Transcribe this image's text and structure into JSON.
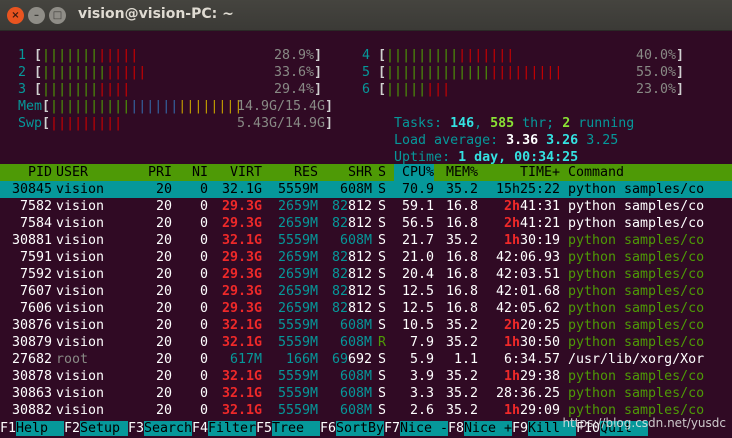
{
  "window": {
    "title": "vision@vision-PC: ~",
    "close_glyph": "×",
    "min_glyph": "–",
    "max_glyph": "□"
  },
  "cpu_meters": [
    {
      "label": "1",
      "bar": "||||||||||||",
      "value": "28.9%",
      "fraction": 0.289
    },
    {
      "label": "2",
      "bar": "|||||||||||||",
      "value": "33.6%",
      "fraction": 0.336
    },
    {
      "label": "3",
      "bar": "|||||||||||",
      "value": "29.4%",
      "fraction": 0.294
    },
    {
      "label": "4",
      "bar": "||||||||||||||||",
      "value": "40.0%",
      "fraction": 0.4
    },
    {
      "label": "5",
      "bar": "||||||||||||||||||||||",
      "value": "55.0%",
      "fraction": 0.55
    },
    {
      "label": "6",
      "bar": "||||||||",
      "value": "23.0%",
      "fraction": 0.23
    }
  ],
  "mem": {
    "label": "Mem",
    "bar": "||||||||||||||||||||||||",
    "value": "14.9G/15.4G"
  },
  "swp": {
    "label": "Swp",
    "bar": "|||||||||",
    "value": "5.43G/14.9G"
  },
  "tasks": {
    "prefix": "Tasks: ",
    "tasks": "146",
    "sep1": ", ",
    "threads": "585",
    "thr": " thr; ",
    "running": "2",
    "running_label": " running"
  },
  "load": {
    "prefix": "Load average: ",
    "l1": "3.36",
    "l5": "3.26",
    "l15": "3.25"
  },
  "uptime": {
    "prefix": "Uptime: ",
    "value": "1 day, 00:34:25"
  },
  "columns": [
    "PID",
    "USER",
    "PRI",
    "NI",
    "VIRT",
    "RES",
    "SHR",
    "S",
    "CPU%",
    "MEM%",
    "TIME+",
    "Command"
  ],
  "processes": [
    {
      "pid": "30845",
      "user": "vision",
      "pri": "20",
      "ni": "0",
      "virt": "32.1G",
      "res": "5559M",
      "shr": "608M",
      "s": "S",
      "cpu": "70.9",
      "mem": "35.2",
      "time_h": "15h",
      "time_r": "25:22",
      "cmd": "python samples/co",
      "selected": true
    },
    {
      "pid": "7582",
      "user": "vision",
      "pri": "20",
      "ni": "0",
      "virt": "29.3G",
      "res": "2659M",
      "shr": "82812",
      "s": "S",
      "cpu": "59.1",
      "mem": "16.8",
      "time_h": "2h",
      "time_r": "41:31",
      "cmd": "python samples/co"
    },
    {
      "pid": "7584",
      "user": "vision",
      "pri": "20",
      "ni": "0",
      "virt": "29.3G",
      "res": "2659M",
      "shr": "82812",
      "s": "S",
      "cpu": "56.5",
      "mem": "16.8",
      "time_h": "2h",
      "time_r": "41:21",
      "cmd": "python samples/co"
    },
    {
      "pid": "30881",
      "user": "vision",
      "pri": "20",
      "ni": "0",
      "virt": "32.1G",
      "res": "5559M",
      "shr": "608M",
      "s": "S",
      "cpu": "21.7",
      "mem": "35.2",
      "time_h": "1h",
      "time_r": "30:19",
      "cmd": "python samples/co",
      "thread": true
    },
    {
      "pid": "7591",
      "user": "vision",
      "pri": "20",
      "ni": "0",
      "virt": "29.3G",
      "res": "2659M",
      "shr": "82812",
      "s": "S",
      "cpu": "21.0",
      "mem": "16.8",
      "time_h": "",
      "time_r": "42:06.93",
      "cmd": "python samples/co",
      "thread": true
    },
    {
      "pid": "7592",
      "user": "vision",
      "pri": "20",
      "ni": "0",
      "virt": "29.3G",
      "res": "2659M",
      "shr": "82812",
      "s": "S",
      "cpu": "20.4",
      "mem": "16.8",
      "time_h": "",
      "time_r": "42:03.51",
      "cmd": "python samples/co",
      "thread": true
    },
    {
      "pid": "7607",
      "user": "vision",
      "pri": "20",
      "ni": "0",
      "virt": "29.3G",
      "res": "2659M",
      "shr": "82812",
      "s": "S",
      "cpu": "12.5",
      "mem": "16.8",
      "time_h": "",
      "time_r": "42:01.68",
      "cmd": "python samples/co",
      "thread": true
    },
    {
      "pid": "7606",
      "user": "vision",
      "pri": "20",
      "ni": "0",
      "virt": "29.3G",
      "res": "2659M",
      "shr": "82812",
      "s": "S",
      "cpu": "12.5",
      "mem": "16.8",
      "time_h": "",
      "time_r": "42:05.62",
      "cmd": "python samples/co",
      "thread": true
    },
    {
      "pid": "30876",
      "user": "vision",
      "pri": "20",
      "ni": "0",
      "virt": "32.1G",
      "res": "5559M",
      "shr": "608M",
      "s": "S",
      "cpu": "10.5",
      "mem": "35.2",
      "time_h": "2h",
      "time_r": "20:25",
      "cmd": "python samples/co",
      "thread": true
    },
    {
      "pid": "30879",
      "user": "vision",
      "pri": "20",
      "ni": "0",
      "virt": "32.1G",
      "res": "5559M",
      "shr": "608M",
      "s": "R",
      "cpu": "7.9",
      "mem": "35.2",
      "time_h": "1h",
      "time_r": "30:50",
      "cmd": "python samples/co",
      "thread": true
    },
    {
      "pid": "27682",
      "user": "root",
      "pri": "20",
      "ni": "0",
      "virt": "617M",
      "res": "166M",
      "shr": "69692",
      "s": "S",
      "cpu": "5.9",
      "mem": "1.1",
      "time_h": "",
      "time_r": "6:34.57",
      "cmd": "/usr/lib/xorg/Xor",
      "root": true
    },
    {
      "pid": "30878",
      "user": "vision",
      "pri": "20",
      "ni": "0",
      "virt": "32.1G",
      "res": "5559M",
      "shr": "608M",
      "s": "S",
      "cpu": "3.9",
      "mem": "35.2",
      "time_h": "1h",
      "time_r": "29:38",
      "cmd": "python samples/co",
      "thread": true
    },
    {
      "pid": "30863",
      "user": "vision",
      "pri": "20",
      "ni": "0",
      "virt": "32.1G",
      "res": "5559M",
      "shr": "608M",
      "s": "S",
      "cpu": "3.3",
      "mem": "35.2",
      "time_h": "",
      "time_r": "28:36.25",
      "cmd": "python samples/co",
      "thread": true
    },
    {
      "pid": "30882",
      "user": "vision",
      "pri": "20",
      "ni": "0",
      "virt": "32.1G",
      "res": "5559M",
      "shr": "608M",
      "s": "S",
      "cpu": "2.6",
      "mem": "35.2",
      "time_h": "1h",
      "time_r": "29:09",
      "cmd": "python samples/co",
      "thread": true
    }
  ],
  "footer": [
    {
      "key": "F1",
      "label": "Help  "
    },
    {
      "key": "F2",
      "label": "Setup "
    },
    {
      "key": "F3",
      "label": "Search"
    },
    {
      "key": "F4",
      "label": "Filter"
    },
    {
      "key": "F5",
      "label": "Tree  "
    },
    {
      "key": "F6",
      "label": "SortBy"
    },
    {
      "key": "F7",
      "label": "Nice -"
    },
    {
      "key": "F8",
      "label": "Nice +"
    },
    {
      "key": "F9",
      "label": "Kill  "
    },
    {
      "key": "F10",
      "label": "Quit  "
    }
  ],
  "watermark": "https://blog.csdn.net/yusdc",
  "colors": {
    "background": "#300a24",
    "header_green": "#4e9a06",
    "cyan": "#06989a",
    "red": "#cc0000"
  }
}
